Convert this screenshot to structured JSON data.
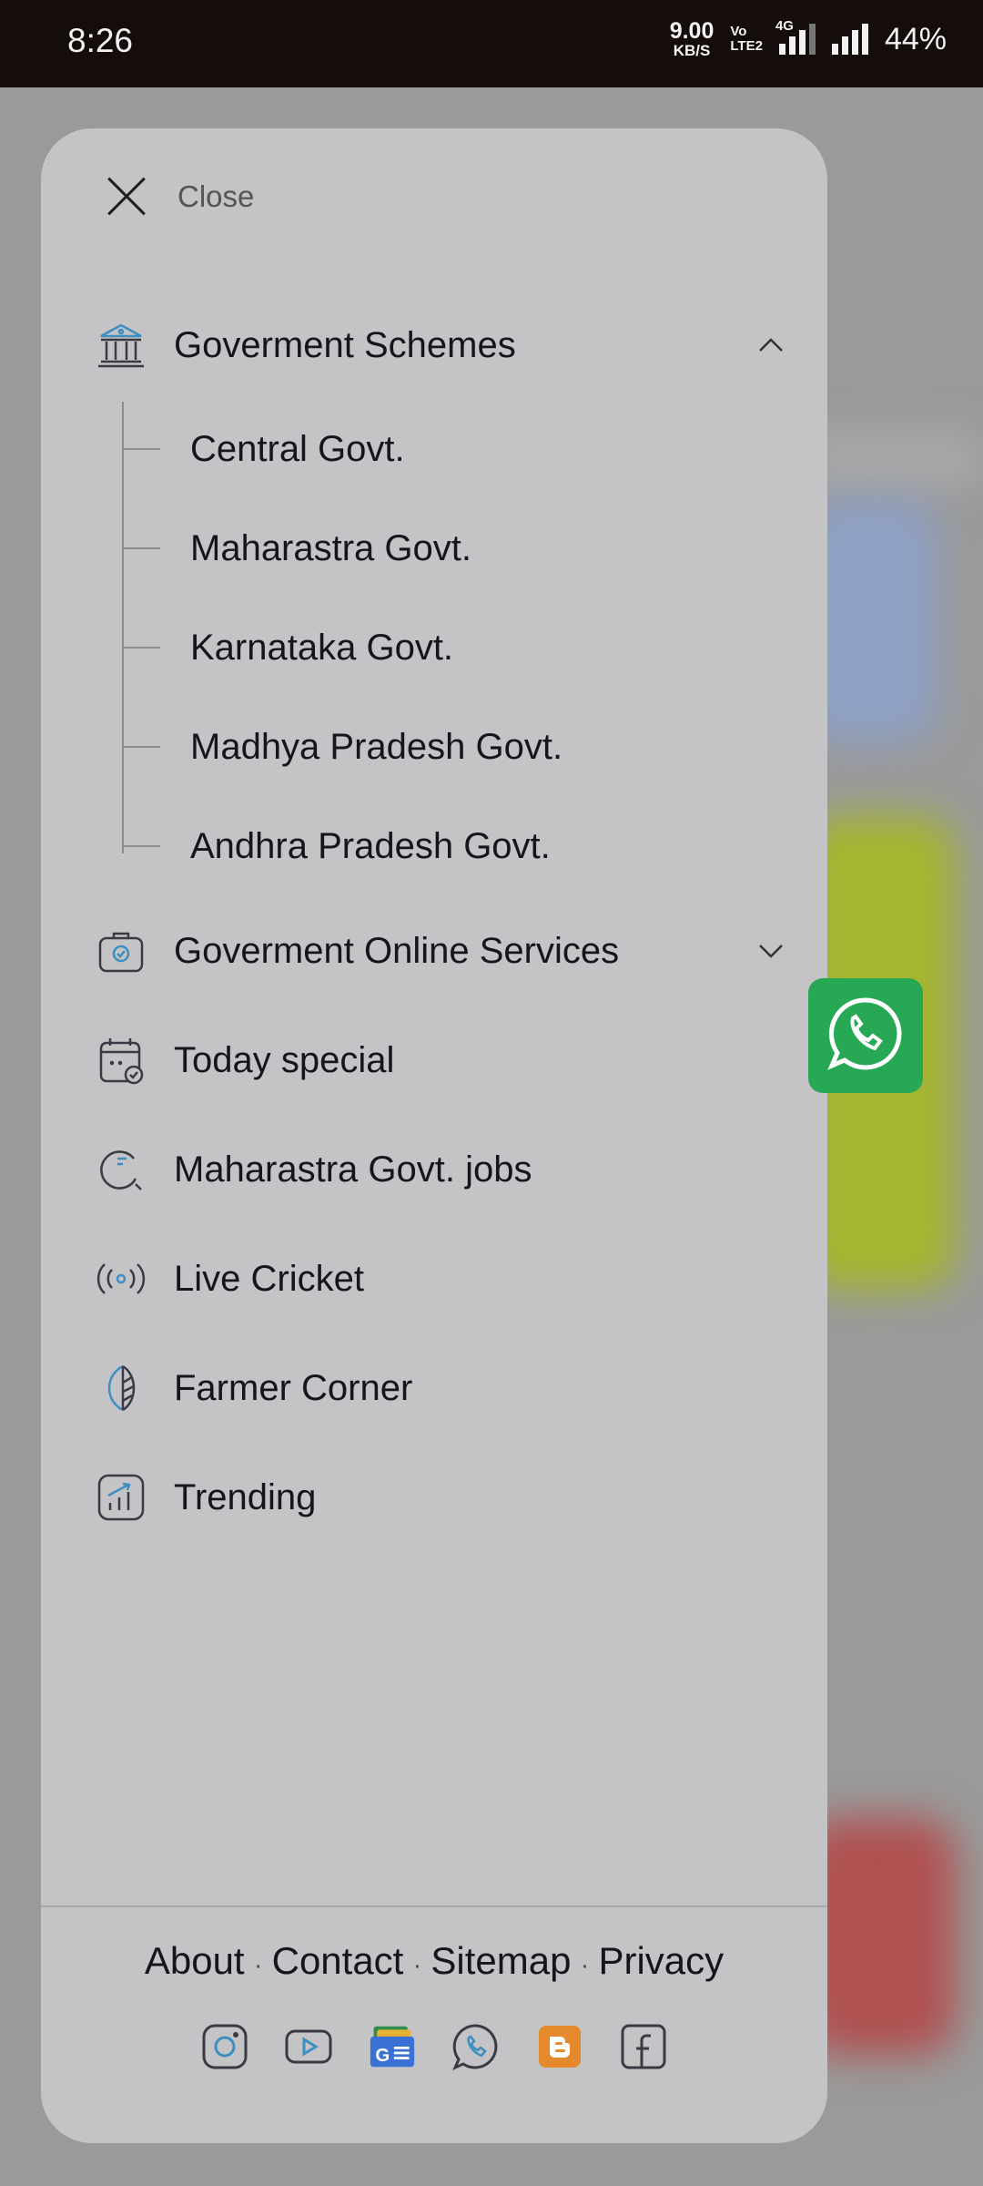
{
  "status_bar": {
    "time": "8:26",
    "net_speed_value": "9.00",
    "net_speed_unit": "KB/S",
    "volte_top": "Vo",
    "volte_bottom": "LTE2",
    "network_type": "4G",
    "battery": "44%"
  },
  "drawer": {
    "close_label": "Close",
    "sections": [
      {
        "label": "Goverment Schemes",
        "icon": "bank-icon",
        "expanded": true,
        "children": [
          "Central Govt.",
          "Maharastra Govt.",
          "Karnataka Govt.",
          "Madhya Pradesh Govt.",
          "Andhra Pradesh Govt."
        ]
      },
      {
        "label": "Goverment Online Services",
        "icon": "briefcase-icon",
        "expanded": false
      },
      {
        "label": "Today special",
        "icon": "calendar-check-icon"
      },
      {
        "label": "Maharastra Govt. jobs",
        "icon": "search-job-icon"
      },
      {
        "label": "Live Cricket",
        "icon": "broadcast-icon"
      },
      {
        "label": "Farmer Corner",
        "icon": "leaf-icon"
      },
      {
        "label": "Trending",
        "icon": "trending-chart-icon"
      }
    ],
    "footer": {
      "links": [
        "About",
        "Contact",
        "Sitemap",
        "Privacy"
      ],
      "separator": "·",
      "socials": [
        "instagram-icon",
        "youtube-icon",
        "google-news-icon",
        "whatsapp-icon",
        "blogger-icon",
        "facebook-icon"
      ]
    }
  },
  "colors": {
    "drawer_bg": "#c4c3c5",
    "status_bar_bg": "#150d0b",
    "icon_accent": "#3d8fc2",
    "whatsapp_green": "#26a855",
    "blogger_orange": "#e5892d"
  }
}
